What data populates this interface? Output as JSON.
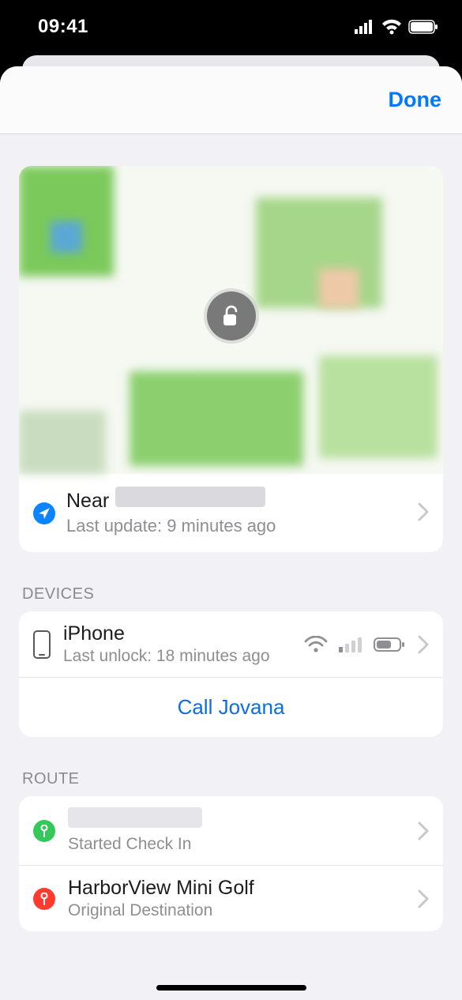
{
  "status": {
    "time": "09:41"
  },
  "nav": {
    "done": "Done"
  },
  "location": {
    "near_prefix": "Near",
    "last_update": "Last update: 9 minutes ago"
  },
  "sections": {
    "devices": "DEVICES",
    "route": "ROUTE"
  },
  "device": {
    "name": "iPhone",
    "sub": "Last unlock: 18 minutes ago",
    "call": "Call Jovana"
  },
  "route": {
    "start_sub": "Started Check In",
    "dest_title": "HarborView Mini Golf",
    "dest_sub": "Original Destination"
  }
}
